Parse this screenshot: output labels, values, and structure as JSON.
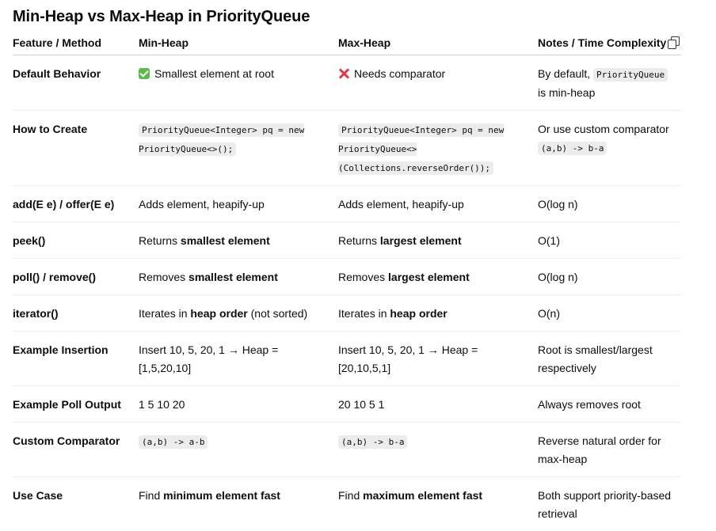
{
  "title": "Min-Heap vs Max-Heap in PriorityQueue",
  "headers": [
    "Feature / Method",
    "Min-Heap",
    "Max-Heap",
    "Notes / Time Complexity"
  ],
  "copy_icon": "copy-icon",
  "rows": [
    {
      "feature": "Default Behavior",
      "min": [
        {
          "t": "icon",
          "v": "check-icon"
        },
        {
          "t": "text",
          "v": "Smallest element at root"
        }
      ],
      "max": [
        {
          "t": "icon",
          "v": "cross-icon"
        },
        {
          "t": "text",
          "v": "Needs comparator"
        }
      ],
      "notes": [
        {
          "t": "text",
          "v": "By default, "
        },
        {
          "t": "code",
          "v": "PriorityQueue"
        },
        {
          "t": "text",
          "v": " is min-heap"
        }
      ]
    },
    {
      "feature": "How to Create",
      "min": [
        {
          "t": "code",
          "v": "PriorityQueue<Integer> pq = new PriorityQueue<>();"
        }
      ],
      "max": [
        {
          "t": "code",
          "v": "PriorityQueue<Integer> pq = new PriorityQueue<>(Collections.reverseOrder());"
        }
      ],
      "notes": [
        {
          "t": "text",
          "v": "Or use custom comparator "
        },
        {
          "t": "code",
          "v": "(a,b) -> b-a"
        }
      ]
    },
    {
      "feature": "add(E e) / offer(E e)",
      "min": [
        {
          "t": "text",
          "v": "Adds element, heapify-up"
        }
      ],
      "max": [
        {
          "t": "text",
          "v": "Adds element, heapify-up"
        }
      ],
      "notes": [
        {
          "t": "text",
          "v": "O(log n)"
        }
      ]
    },
    {
      "feature": "peek()",
      "min": [
        {
          "t": "text",
          "v": "Returns "
        },
        {
          "t": "bold",
          "v": "smallest element"
        }
      ],
      "max": [
        {
          "t": "text",
          "v": "Returns "
        },
        {
          "t": "bold",
          "v": "largest element"
        }
      ],
      "notes": [
        {
          "t": "text",
          "v": "O(1)"
        }
      ]
    },
    {
      "feature": "poll() / remove()",
      "min": [
        {
          "t": "text",
          "v": "Removes "
        },
        {
          "t": "bold",
          "v": "smallest element"
        }
      ],
      "max": [
        {
          "t": "text",
          "v": "Removes "
        },
        {
          "t": "bold",
          "v": "largest element"
        }
      ],
      "notes": [
        {
          "t": "text",
          "v": "O(log n)"
        }
      ]
    },
    {
      "feature": "iterator()",
      "min": [
        {
          "t": "text",
          "v": "Iterates in "
        },
        {
          "t": "bold",
          "v": "heap order"
        },
        {
          "t": "text",
          "v": " (not sorted)"
        }
      ],
      "max": [
        {
          "t": "text",
          "v": "Iterates in "
        },
        {
          "t": "bold",
          "v": "heap order"
        }
      ],
      "notes": [
        {
          "t": "text",
          "v": "O(n)"
        }
      ]
    },
    {
      "feature": "Example Insertion",
      "min": [
        {
          "t": "text",
          "v": "Insert 10, 5, 20, 1 → Heap = [1,5,20,10]"
        }
      ],
      "max": [
        {
          "t": "text",
          "v": "Insert 10, 5, 20, 1 → Heap = [20,10,5,1]"
        }
      ],
      "notes": [
        {
          "t": "text",
          "v": "Root is smallest/largest respectively"
        }
      ]
    },
    {
      "feature": "Example Poll Output",
      "min": [
        {
          "t": "text",
          "v": "1 5 10 20"
        }
      ],
      "max": [
        {
          "t": "text",
          "v": "20 10 5 1"
        }
      ],
      "notes": [
        {
          "t": "text",
          "v": "Always removes root"
        }
      ]
    },
    {
      "feature": "Custom Comparator",
      "min": [
        {
          "t": "code",
          "v": "(a,b) -> a-b"
        }
      ],
      "max": [
        {
          "t": "code",
          "v": "(a,b) -> b-a"
        }
      ],
      "notes": [
        {
          "t": "text",
          "v": "Reverse natural order for max-heap"
        }
      ]
    },
    {
      "feature": "Use Case",
      "min": [
        {
          "t": "text",
          "v": "Find "
        },
        {
          "t": "bold",
          "v": "minimum element fast"
        }
      ],
      "max": [
        {
          "t": "text",
          "v": "Find "
        },
        {
          "t": "bold",
          "v": "maximum element fast"
        }
      ],
      "notes": [
        {
          "t": "text",
          "v": "Both support priority-based retrieval"
        }
      ]
    }
  ]
}
